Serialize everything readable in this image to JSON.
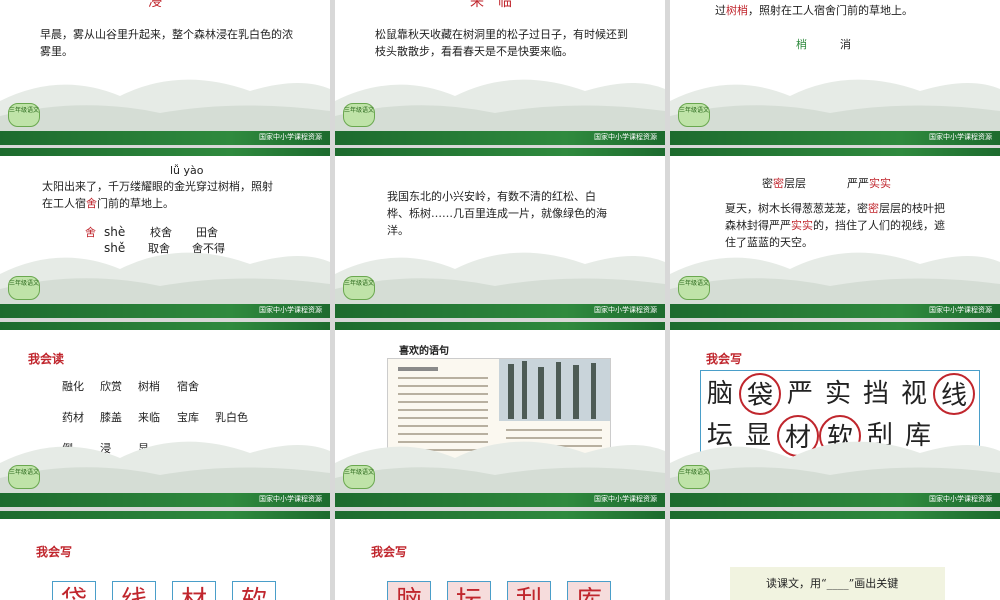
{
  "footer_label": "国家中小学课程资源",
  "logo_label": "三年级语文",
  "s1": {
    "title": "浸",
    "text": "早晨，雾从山谷里升起来，整个森林浸在乳白色的浓雾里。"
  },
  "s2": {
    "title": "来　临",
    "text": "松鼠靠秋天收藏在树洞里的松子过日子，有时候还到枝头散散步，看看春天是不是快要来临。"
  },
  "s3": {
    "text_pre": "过",
    "text_red": "树梢",
    "text_post": "，照射在工人宿舍门前的草地上。",
    "w1": "梢",
    "w2": "消"
  },
  "s4": {
    "pinyin": "lǚ yào",
    "text_a": "太阳出来了，千万缕耀眼的金光穿过树梢，照射在工人宿",
    "text_red": "舍",
    "text_b": "门前的草地上。",
    "c_red": "舍",
    "p1": "shè",
    "p2": "shě",
    "w1": "校舍",
    "w2": "田舍",
    "w3": "取舍",
    "w4": "舍不得"
  },
  "s5": {
    "text": "我国东北的小兴安岭，有数不清的红松、白桦、栎树……几百里连成一片，就像绿色的海洋。"
  },
  "s6": {
    "h1a": "密",
    "h1b": "密",
    "h1c": "层层",
    "h2a": "严严",
    "h2b": "实实",
    "text_a": "夏天，树木长得葱葱茏茏，密",
    "text_red1": "密",
    "text_b": "层层的枝叶把森林封得严严",
    "text_red2": "实实",
    "text_c": "的，挡住了人们的视线，遮住了蓝蓝的天空。"
  },
  "s7": {
    "heading": "我会读",
    "rows": [
      [
        "融化",
        "欣赏",
        "树梢",
        "宿舍"
      ],
      [
        "药材",
        "膝盖",
        "来临",
        "宝库",
        "乳白色"
      ],
      [
        "倒",
        "浸",
        "显"
      ]
    ]
  },
  "s8": {
    "heading": "喜欢的语句"
  },
  "s9": {
    "heading": "我会写",
    "row1": [
      "脑",
      "袋",
      "严",
      "实",
      "挡",
      "视",
      "线"
    ],
    "row2": [
      "坛",
      "显",
      "材",
      "软",
      "刮",
      "库"
    ]
  },
  "s10": {
    "heading": "我会写",
    "chars": [
      "袋",
      "线",
      "材",
      "软"
    ]
  },
  "s11": {
    "heading": "我会写",
    "chars": [
      "脑",
      "坛",
      "刮",
      "库"
    ]
  },
  "s12": {
    "text": "读课文，用“____”画出关键"
  }
}
